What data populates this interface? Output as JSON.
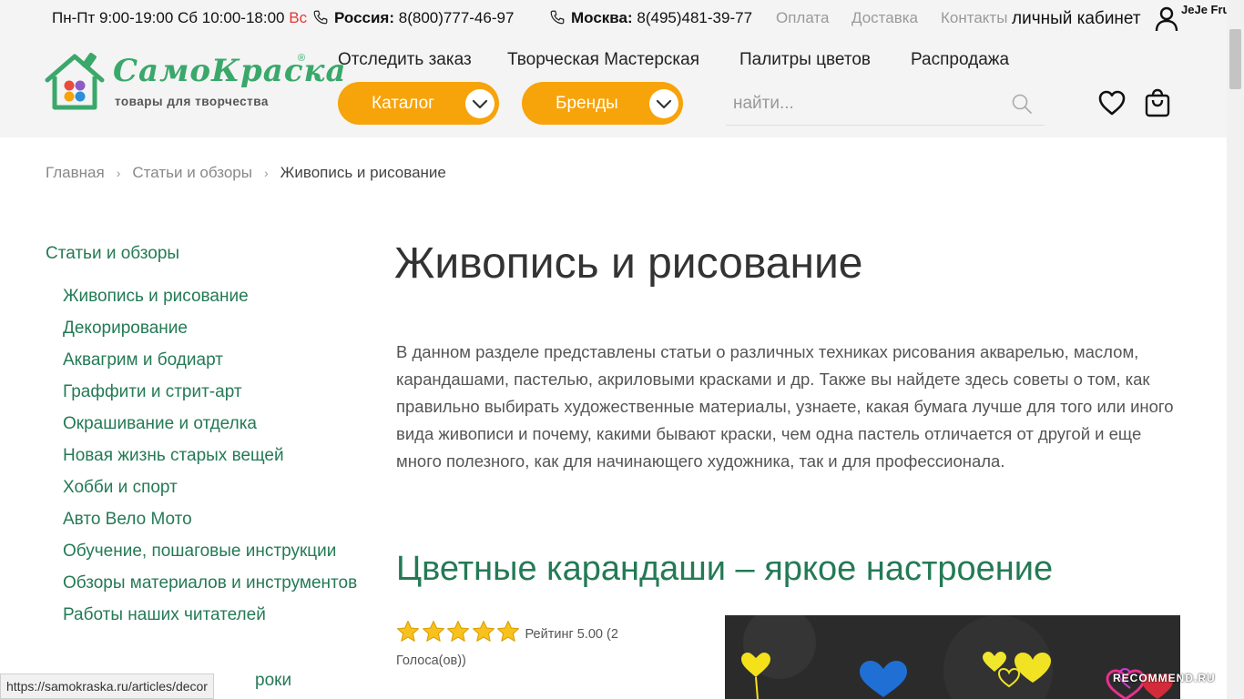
{
  "topbar": {
    "hours": "Пн-Пт 9:00-19:00 Сб 10:00-18:00",
    "sunday": "Вс",
    "russia_label": "Россия:",
    "russia_phone": "8(800)777-46-97",
    "moscow_label": "Москва:",
    "moscow_phone": "8(495)481-39-77",
    "links": [
      "Оплата",
      "Доставка",
      "Контакты"
    ],
    "cabinet": "личный кабинет",
    "username": "JeJe Fruje"
  },
  "logo": {
    "word": "СамоКраска",
    "registered": "®",
    "tagline": "товары для творчества"
  },
  "nav": {
    "items": [
      "Отследить заказ",
      "Творческая Мастерская",
      "Палитры цветов",
      "Распродажа"
    ],
    "catalog": "Каталог",
    "brands": "Бренды"
  },
  "search": {
    "placeholder": "найти..."
  },
  "breadcrumb": {
    "items": [
      "Главная",
      "Статьи и обзоры",
      "Живопись и рисование"
    ],
    "separator": "›"
  },
  "sidebar": {
    "title": "Статьи и обзоры",
    "items": [
      "Живопись и рисование",
      "Декорирование",
      "Аквагрим и бодиарт",
      "Граффити и стрит-арт",
      "Окрашивание и отделка",
      "Новая жизнь старых вещей",
      "Хобби и спорт",
      "Авто Вело Мото",
      "Обучение, пошаговые инструкции",
      "Обзоры материалов и инструментов",
      "Работы наших читателей"
    ],
    "partial_item": "роки"
  },
  "main": {
    "title": "Живопись и рисование",
    "intro": "В данном разделе представлены статьи о различных техниках рисования акварелью, маслом, карандашами, пастелью, акриловыми красками и др. Также вы найдете здесь советы о том, как правильно выбирать художественные материалы, узнаете, какая бумага лучше для того или иного вида живописи и почему, какими бывают краски, чем одна пастель отличается от другой и еще много полезного, как для начинающего художника, так и для профессионала.",
    "article_title": "Цветные карандаши – яркое настроение",
    "rating_text": "Рейтинг 5.00 (2",
    "rating_votes": "Голоса(ов))",
    "rating_value": 5,
    "rating_max": 5
  },
  "status_url": "https://samokraska.ru/articles/decor",
  "watermark": "RECOMMEND.RU",
  "colors": {
    "accent_orange": "#f7a30a",
    "brand_green": "#247a55",
    "header_bg": "#f4f4f4",
    "sunday_red": "#e53935"
  }
}
